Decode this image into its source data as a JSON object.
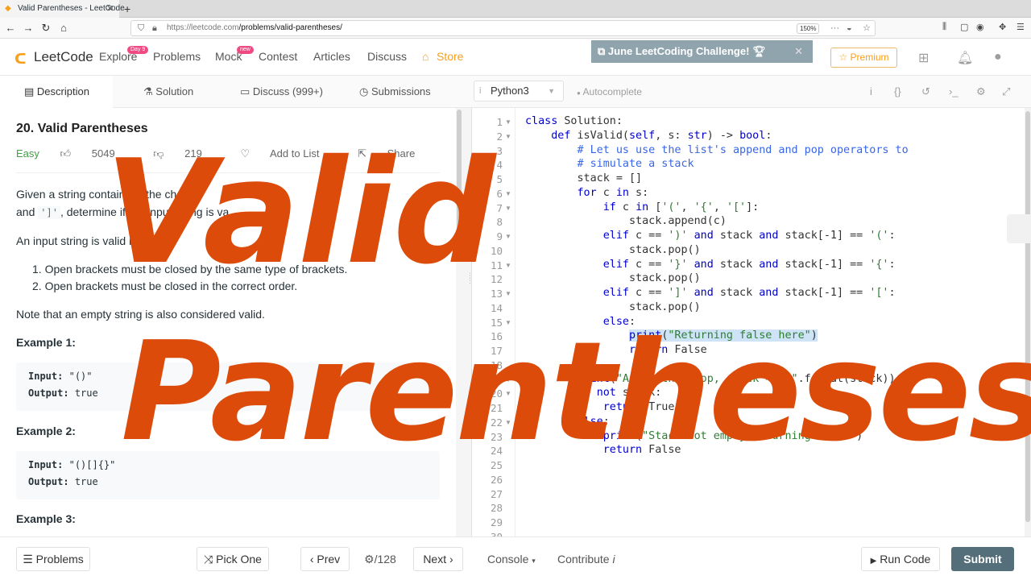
{
  "browser": {
    "tab_title": "Valid Parentheses - LeetCode",
    "url_host": "https://leetcode.com",
    "url_path": "/problems/valid-parentheses/",
    "zoom": "150%"
  },
  "nav": {
    "brand": "LeetCode",
    "items": [
      "Explore",
      "Problems",
      "Mock",
      "Contest",
      "Articles",
      "Discuss",
      "Store"
    ],
    "explore_badge": "Day 9",
    "mock_badge": "new",
    "challenge": "June LeetCoding Challenge!",
    "premium": "Premium"
  },
  "tabs": {
    "description": "Description",
    "solution": "Solution",
    "discuss": "Discuss (999+)",
    "submissions": "Submissions",
    "language": "Python3",
    "autocomplete": "Autocomplete"
  },
  "problem": {
    "title": "20. Valid Parentheses",
    "difficulty": "Easy",
    "likes": "5049",
    "dislikes": "219",
    "add_to_list": "Add to List",
    "share": "Share",
    "para1_a": "Given a string containi",
    "para1_b": "ust the chara",
    "para1_c": "and",
    "para1_code": "']'",
    "para1_d": ", determine if the input string is va",
    "para2": "An input string is valid if",
    "rule1": "Open brackets must be closed by the same type of brackets.",
    "rule2": "Open brackets must be closed in the correct order.",
    "note": "Note that an empty string is also considered valid.",
    "examples": [
      {
        "heading": "Example 1:",
        "input": "\"()\"",
        "output": "true"
      },
      {
        "heading": "Example 2:",
        "input": "\"()[]{}\"",
        "output": "true"
      },
      {
        "heading": "Example 3:"
      }
    ],
    "input_label": "Input:",
    "output_label": "Output:"
  },
  "code_lines": [
    "class Solution:",
    "    def isValid(self, s: str) -> bool:",
    "        # Let us use the list's append and pop operators to",
    "        # simulate a stack",
    "        stack = []",
    "        for c in s:",
    "            if c in ['(', '{', '[']:",
    "                stack.append(c)",
    "            elif c == ')' and stack and stack[-1] == '(':",
    "                stack.pop()",
    "            elif c == '}' and stack and stack[-1] == '{':",
    "                stack.pop()",
    "            elif c == ']' and stack and stack[-1] == '[':",
    "                stack.pop()",
    "            else:",
    "                print(\"Returning false here\")",
    "                return False",
    "",
    "        print(\"After the loop, stack = {}\".format(stack))",
    "        if not stack:",
    "            return True",
    "        else:",
    "            print(\"Stack not empty Returning false\")",
    "            return False",
    "",
    "",
    "",
    "",
    "",
    ""
  ],
  "bottom": {
    "problems": "Problems",
    "pick_one": "Pick One",
    "prev": "Prev",
    "counter": "/128",
    "next": "Next",
    "console": "Console",
    "contribute": "Contribute",
    "run_code": "Run Code",
    "submit": "Submit"
  },
  "overlay": {
    "line1": "Valid",
    "line2": "Parentheses",
    "color": "#dc4b0a"
  }
}
